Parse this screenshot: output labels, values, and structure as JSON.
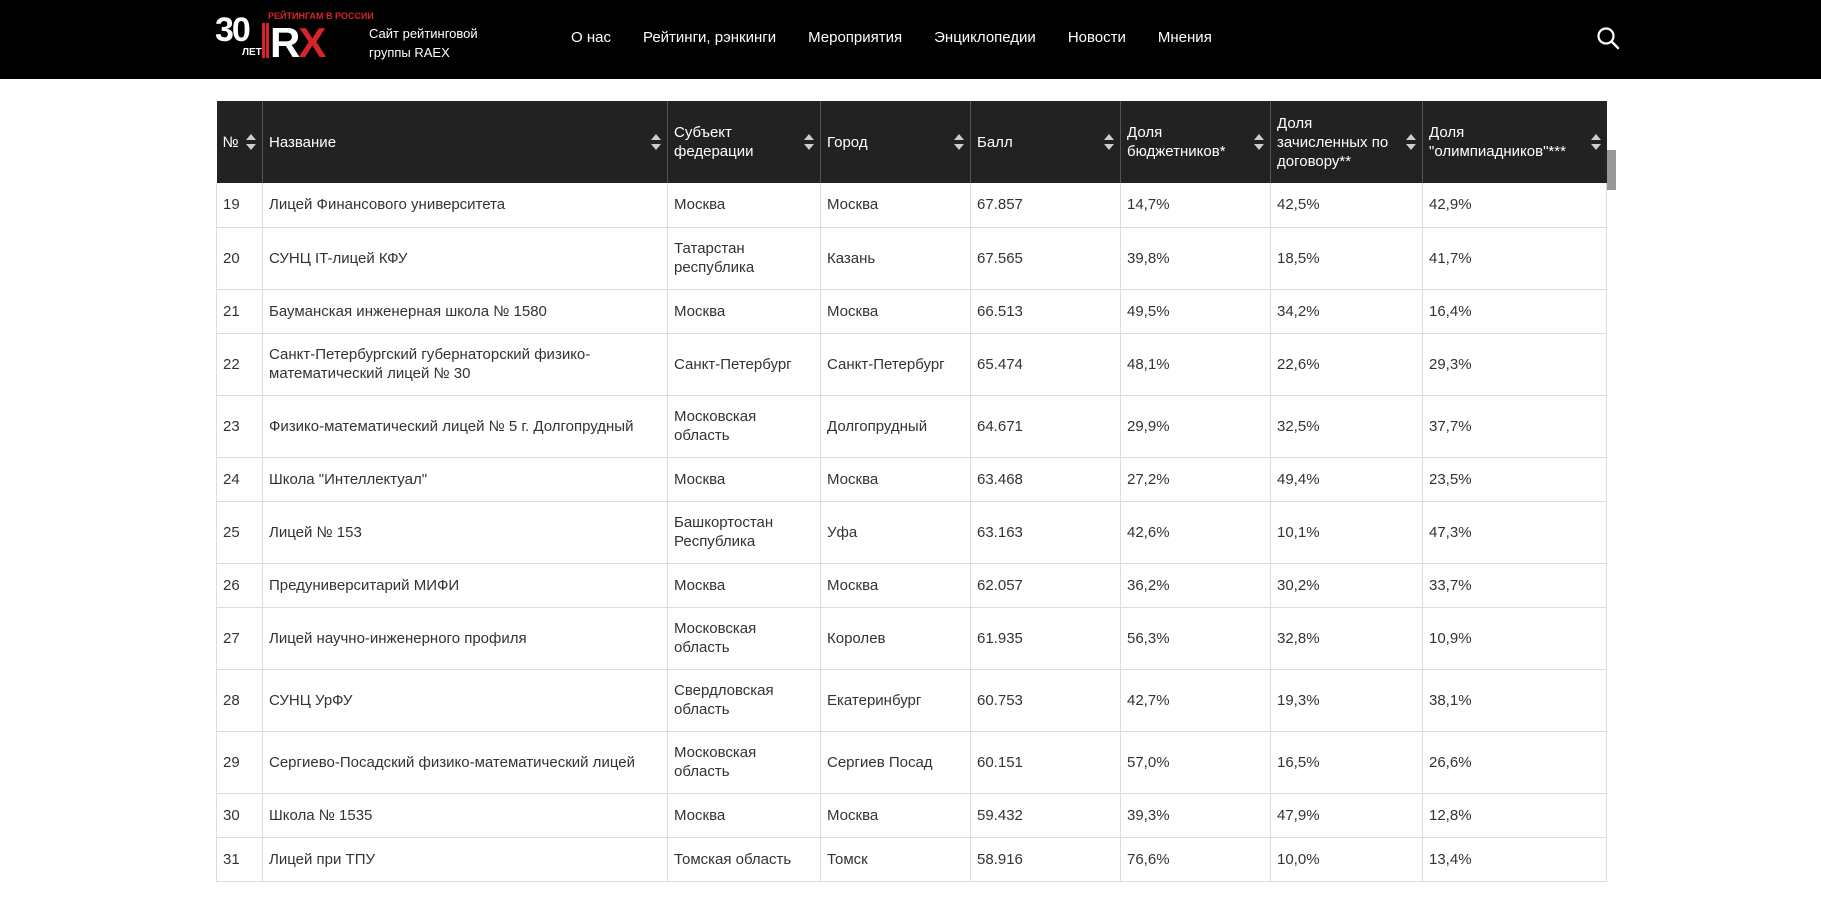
{
  "header": {
    "logo": {
      "years": "30",
      "years_label": "ЛЕТ",
      "brand": "RX",
      "brand_tagline": "РЕЙТИНГАМ В РОССИИ"
    },
    "site_description": "Сайт рейтинговой группы RAEX",
    "nav": [
      "О нас",
      "Рейтинги, рэнкинги",
      "Мероприятия",
      "Энциклопедии",
      "Новости",
      "Мнения"
    ],
    "search_icon": "search-icon"
  },
  "table": {
    "columns": [
      "№",
      "Название",
      "Субъект федерации",
      "Город",
      "Балл",
      "Доля бюджетников*",
      "Доля зачисленных по договору**",
      "Доля \"олимпиадников\"***"
    ],
    "rows": [
      [
        "19",
        "Лицей Финансового университета",
        "Москва",
        "Москва",
        "67.857",
        "14,7%",
        "42,5%",
        "42,9%"
      ],
      [
        "20",
        "СУНЦ IT-лицей КФУ",
        "Татарстан республика",
        "Казань",
        "67.565",
        "39,8%",
        "18,5%",
        "41,7%"
      ],
      [
        "21",
        "Бауманская инженерная школа № 1580",
        "Москва",
        "Москва",
        "66.513",
        "49,5%",
        "34,2%",
        "16,4%"
      ],
      [
        "22",
        "Санкт-Петербургский губернаторский физико-математический лицей № 30",
        "Санкт-Петербург",
        "Санкт-Петербург",
        "65.474",
        "48,1%",
        "22,6%",
        "29,3%"
      ],
      [
        "23",
        "Физико-математический лицей № 5 г. Долгопрудный",
        "Московская область",
        "Долгопрудный",
        "64.671",
        "29,9%",
        "32,5%",
        "37,7%"
      ],
      [
        "24",
        "Школа \"Интеллектуал\"",
        "Москва",
        "Москва",
        "63.468",
        "27,2%",
        "49,4%",
        "23,5%"
      ],
      [
        "25",
        "Лицей № 153",
        "Башкортостан Республика",
        "Уфа",
        "63.163",
        "42,6%",
        "10,1%",
        "47,3%"
      ],
      [
        "26",
        "Предуниверситарий МИФИ",
        "Москва",
        "Москва",
        "62.057",
        "36,2%",
        "30,2%",
        "33,7%"
      ],
      [
        "27",
        "Лицей научно-инженерного профиля",
        "Московская область",
        "Королев",
        "61.935",
        "56,3%",
        "32,8%",
        "10,9%"
      ],
      [
        "28",
        "СУНЦ УрФУ",
        "Свердловская область",
        "Екатеринбург",
        "60.753",
        "42,7%",
        "19,3%",
        "38,1%"
      ],
      [
        "29",
        "Сергиево-Посадский физико-математический лицей",
        "Московская область",
        "Сергиев Посад",
        "60.151",
        "57,0%",
        "16,5%",
        "26,6%"
      ],
      [
        "30",
        "Школа № 1535",
        "Москва",
        "Москва",
        "59.432",
        "39,3%",
        "47,9%",
        "12,8%"
      ],
      [
        "31",
        "Лицей при ТПУ",
        "Томская область",
        "Томск",
        "58.916",
        "76,6%",
        "10,0%",
        "13,4%"
      ]
    ]
  },
  "colors": {
    "header_bg": "#000000",
    "table_header_bg": "#222222",
    "accent": "#d8232a"
  }
}
